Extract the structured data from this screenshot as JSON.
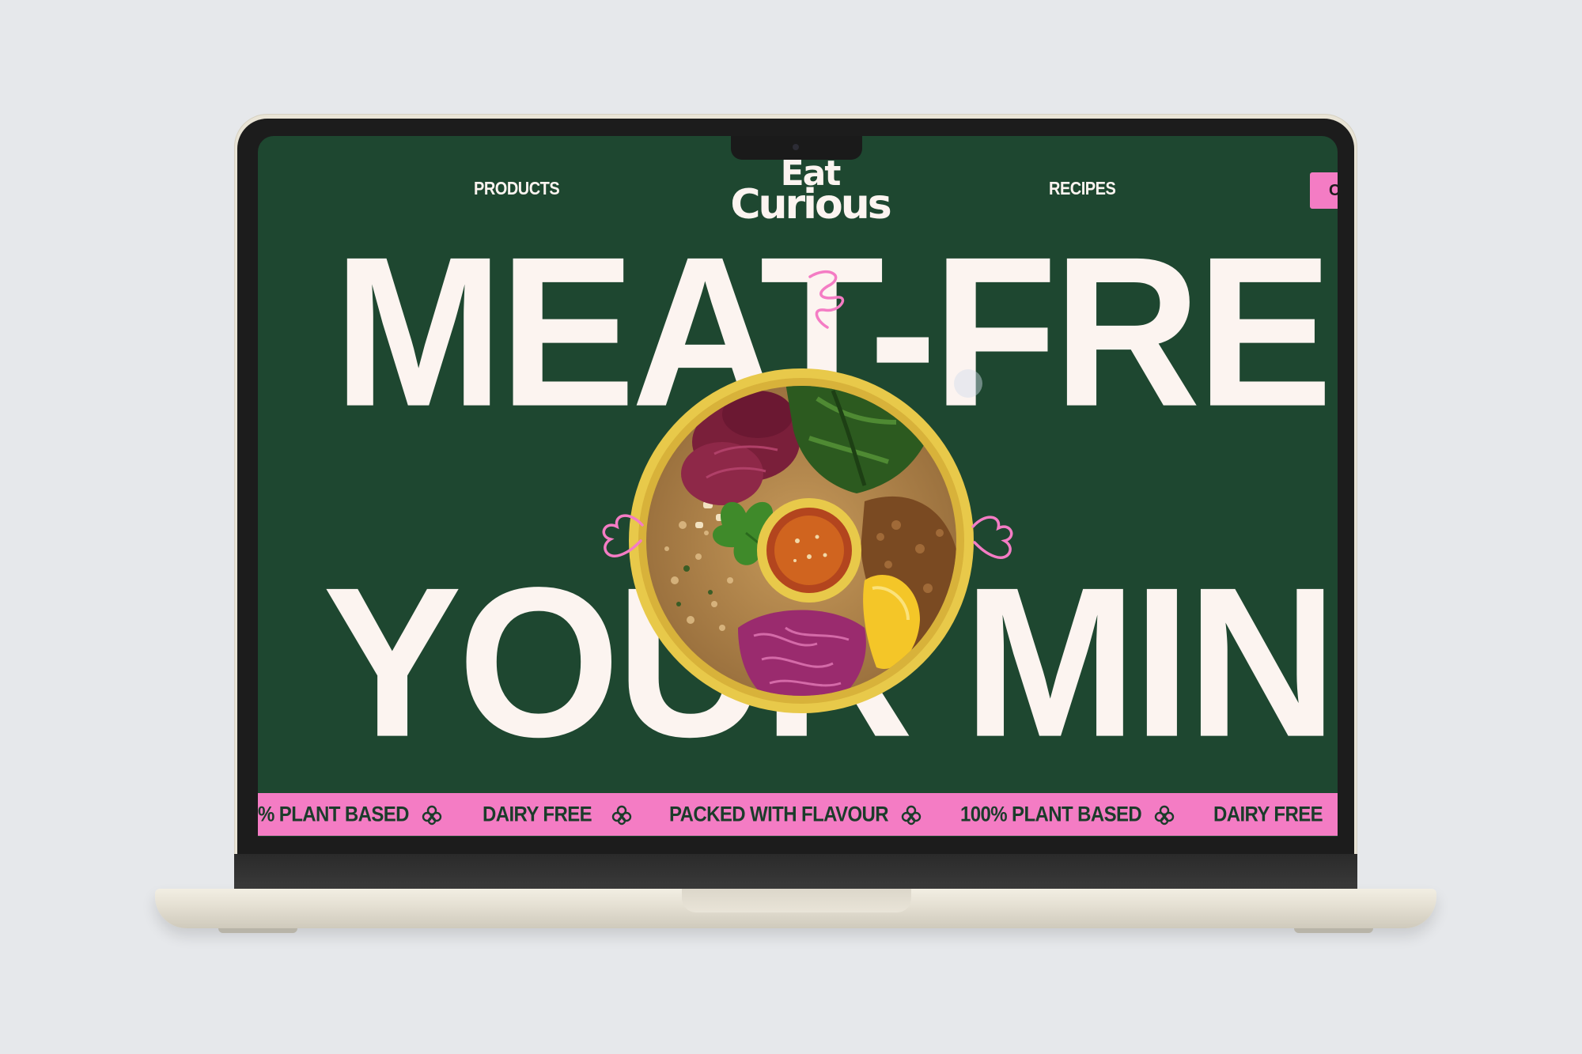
{
  "nav": {
    "products_label": "PRODUCTS",
    "recipes_label": "RECIPES",
    "cta_label": "C"
  },
  "brand": {
    "logo_line1": "Eat",
    "logo_line2": "Curious"
  },
  "hero": {
    "line1": "MEAT-FREE",
    "line2": "YOUR MIND"
  },
  "marquee": {
    "items": [
      "% PLANT BASED",
      "DAIRY FREE",
      "PACKED WITH FLAVOUR",
      "100% PLANT BASED",
      "DAIRY FREE"
    ]
  },
  "colors": {
    "background": "#1e4730",
    "headline": "#fcf4f0",
    "accent_pink": "#f47cc4",
    "marquee_text": "#1b3c2a"
  },
  "icons": {
    "marquee_separator": "flower-icon"
  }
}
